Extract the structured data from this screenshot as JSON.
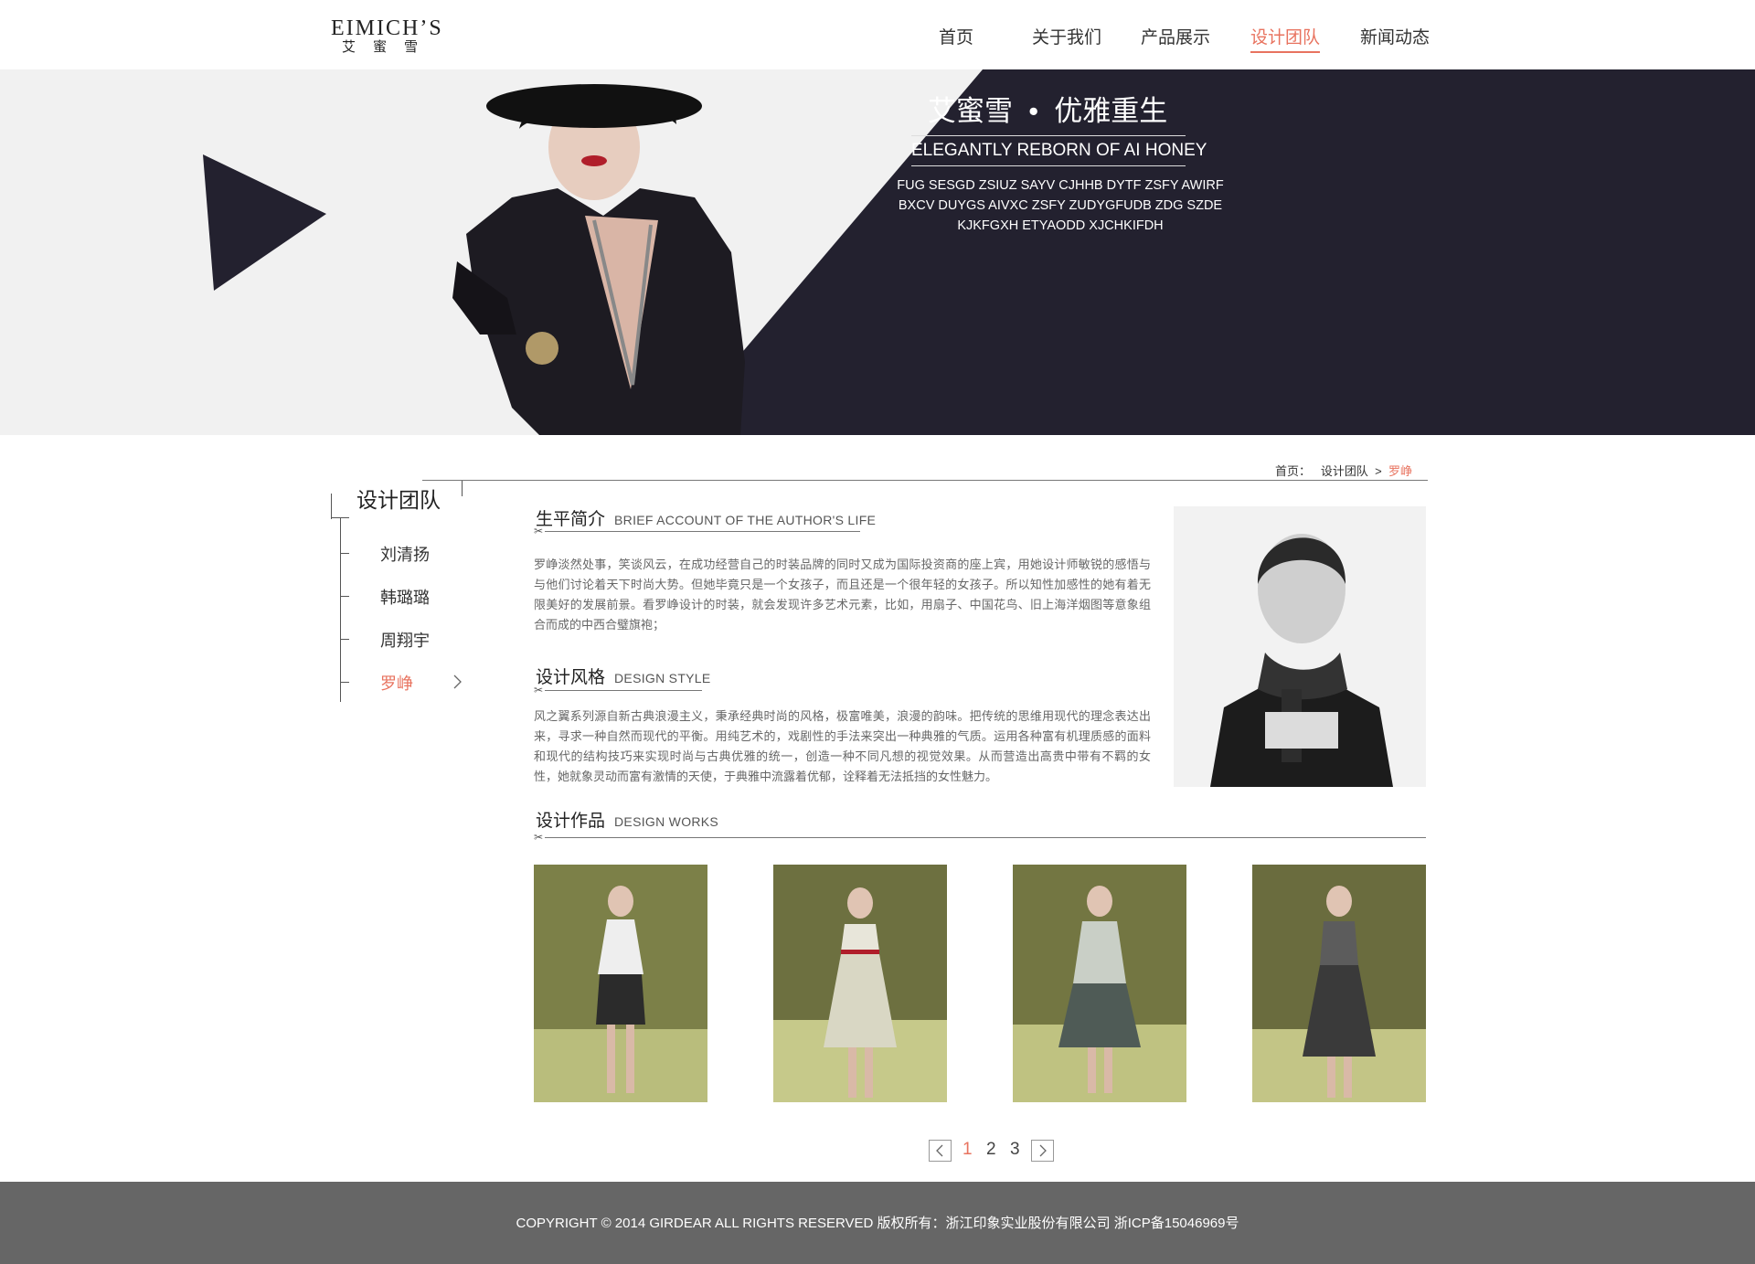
{
  "logo": {
    "en": "EIMICH’S",
    "cn": "艾蜜雪"
  },
  "nav": [
    "首页",
    "关于我们",
    "产品展示",
    "设计团队",
    "新闻动态"
  ],
  "nav_active": "设计团队",
  "banner": {
    "title": "艾蜜雪  •  优雅重生",
    "subtitle": "ELEGANTLY REBORN OF AI HONEY",
    "lines": [
      "FUG SESGD ZSIUZ SAYV CJHHB DYTF ZSFY AWIRF",
      "BXCV DUYGS AIVXC ZSFY ZUDYGFUDB ZDG SZDE",
      "KJKFGXH ETYAODD XJCHKIFDH"
    ]
  },
  "sidebar": {
    "title": "设计团队",
    "items": [
      "刘清扬",
      "韩璐璐",
      "周翔宇",
      "罗峥"
    ]
  },
  "breadcrumb": {
    "home": "首页：",
    "section": "设计团队",
    "current": "罗峥"
  },
  "bio": {
    "title_cn": "生平简介",
    "title_en": "BRIEF ACCOUNT OF THE AUTHOR'S LIFE",
    "text": "罗峥淡然处事，笑谈风云，在成功经营自己的时装品牌的同时又成为国际投资商的座上宾，用她设计师敏锐的感悟与与他们讨论着天下时尚大势。但她毕竟只是一个女孩子，而且还是一个很年轻的女孩子。所以知性加感性的她有着无限美好的发展前景。看罗峥设计的时装，就会发现许多艺术元素，比如，用扇子、中国花鸟、旧上海洋烟图等意象组合而成的中西合璧旗袍；"
  },
  "style": {
    "title_cn": "设计风格",
    "title_en": "DESIGN STYLE",
    "text": "风之翼系列源自新古典浪漫主义，秉承经典时尚的风格，极富唯美，浪漫的韵味。把传统的思维用现代的理念表达出来，寻求一种自然而现代的平衡。用纯艺术的，戏剧性的手法来突出一种典雅的气质。运用各种富有机理质感的面料和现代的结构技巧来实现时尚与古典优雅的统一，创造一种不同凡想的视觉效果。从而营造出高贵中带有不羁的女性，她就象灵动而富有激情的天使，于典雅中流露着优郁，诠释着无法抵挡的女性魅力。"
  },
  "works": {
    "title_cn": "设计作品",
    "title_en": "DESIGN WORKS"
  },
  "pagination": {
    "pages": [
      "1",
      "2",
      "3"
    ],
    "current": "1"
  },
  "footer": "COPYRIGHT © 2014 GIRDEAR ALL RIGHTS RESERVED 版权所有：浙江印象实业股份有限公司  浙ICP备15046969号",
  "colors": {
    "accent": "#e8735f",
    "banner_dark": "#23212f",
    "footer": "#666666"
  }
}
